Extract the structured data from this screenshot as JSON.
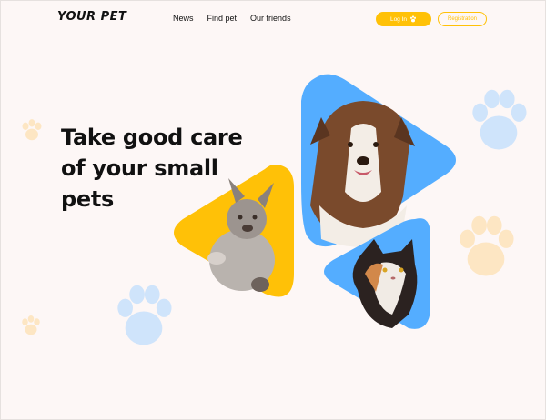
{
  "header": {
    "logo_text": "YOUR PET",
    "nav": [
      {
        "label": "News"
      },
      {
        "label": "Find pet"
      },
      {
        "label": "Our friends"
      }
    ],
    "login_label": "Log In",
    "register_label": "Registration"
  },
  "hero": {
    "title_lines": [
      "Take good care",
      "of your small",
      "pets"
    ]
  },
  "colors": {
    "accent": "#ffc107",
    "blue": "#54adff",
    "background": "#fdf7f6",
    "paw_blue": "#cfe4fb",
    "paw_orange": "#fde6c3"
  },
  "images": [
    {
      "name": "french-bulldog-photo"
    },
    {
      "name": "border-collie-photo"
    },
    {
      "name": "calico-cat-photo"
    }
  ]
}
